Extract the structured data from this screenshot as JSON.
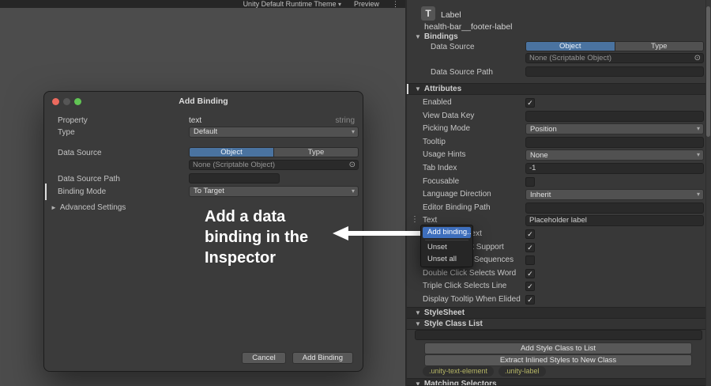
{
  "colors": {
    "selected_tab_blue": "#4a73a0",
    "menu_highlight_blue": "#3e6fbd",
    "style_class_text": "#b5b565"
  },
  "topbar": {
    "theme_selector": "Unity Default Runtime Theme",
    "preview_label": "Preview"
  },
  "dialog": {
    "title": "Add Binding",
    "property_label": "Property",
    "property_value": "text",
    "property_type": "string",
    "type_label": "Type",
    "type_value": "Default",
    "data_source_label": "Data Source",
    "object_tab": "Object",
    "type_tab": "Type",
    "object_field_value": "None (Scriptable Object)",
    "data_source_path_label": "Data Source Path",
    "binding_mode_label": "Binding Mode",
    "binding_mode_value": "To Target",
    "advanced_settings_label": "Advanced Settings",
    "cancel_button": "Cancel",
    "add_binding_button": "Add Binding"
  },
  "annotation": {
    "line1": "Add a data",
    "line2": "binding in the",
    "line3": "Inspector"
  },
  "context_menu": {
    "items": [
      {
        "label": "Add binding...",
        "highlighted": true,
        "separator_after": true
      },
      {
        "label": "Unset",
        "highlighted": false,
        "separator_after": false
      },
      {
        "label": "Unset all",
        "highlighted": false,
        "separator_after": false
      }
    ]
  },
  "inspector": {
    "element_type": "Label",
    "element_name": "health-bar__footer-label",
    "bindings": {
      "title": "Bindings",
      "data_source_label": "Data Source",
      "object_tab": "Object",
      "type_tab": "Type",
      "object_field_value": "None (Scriptable Object)",
      "data_source_path_label": "Data Source Path"
    },
    "attributes": {
      "title": "Attributes",
      "rows": [
        {
          "label": "Enabled",
          "type": "checkbox",
          "checked": true
        },
        {
          "label": "View Data Key",
          "type": "field",
          "value": ""
        },
        {
          "label": "Picking Mode",
          "type": "dropdown",
          "value": "Position"
        },
        {
          "label": "Tooltip",
          "type": "field",
          "value": ""
        },
        {
          "label": "Usage Hints",
          "type": "dropdown",
          "value": "None"
        },
        {
          "label": "Tab Index",
          "type": "field",
          "value": "-1"
        },
        {
          "label": "Focusable",
          "type": "checkbox",
          "checked": false
        },
        {
          "label": "Language Direction",
          "type": "dropdown",
          "value": "Inherit"
        },
        {
          "label": "Editor Binding Path",
          "type": "field",
          "value": ""
        },
        {
          "label": "Text",
          "type": "field",
          "value": "Placeholder label",
          "marker": true
        },
        {
          "label": "Enable Rich Text",
          "type": "checkbox",
          "checked": true
        },
        {
          "label": "Emoji Fallback Support",
          "type": "checkbox",
          "checked": true
        },
        {
          "label": "Parse Escape Sequences",
          "type": "checkbox",
          "checked": false
        },
        {
          "label": "Double Click Selects Word",
          "type": "checkbox",
          "checked": true
        },
        {
          "label": "Triple Click Selects Line",
          "type": "checkbox",
          "checked": true
        },
        {
          "label": "Display Tooltip When Elided",
          "type": "checkbox",
          "checked": true
        }
      ]
    },
    "stylesheet": {
      "title": "StyleSheet"
    },
    "style_class_list": {
      "title": "Style Class List",
      "add_button": "Add Style Class to List",
      "extract_button": "Extract Inlined Styles to New Class",
      "classes": [
        ".unity-text-element",
        ".unity-label"
      ]
    },
    "matching_selectors": {
      "title": "Matching Selectors"
    }
  }
}
